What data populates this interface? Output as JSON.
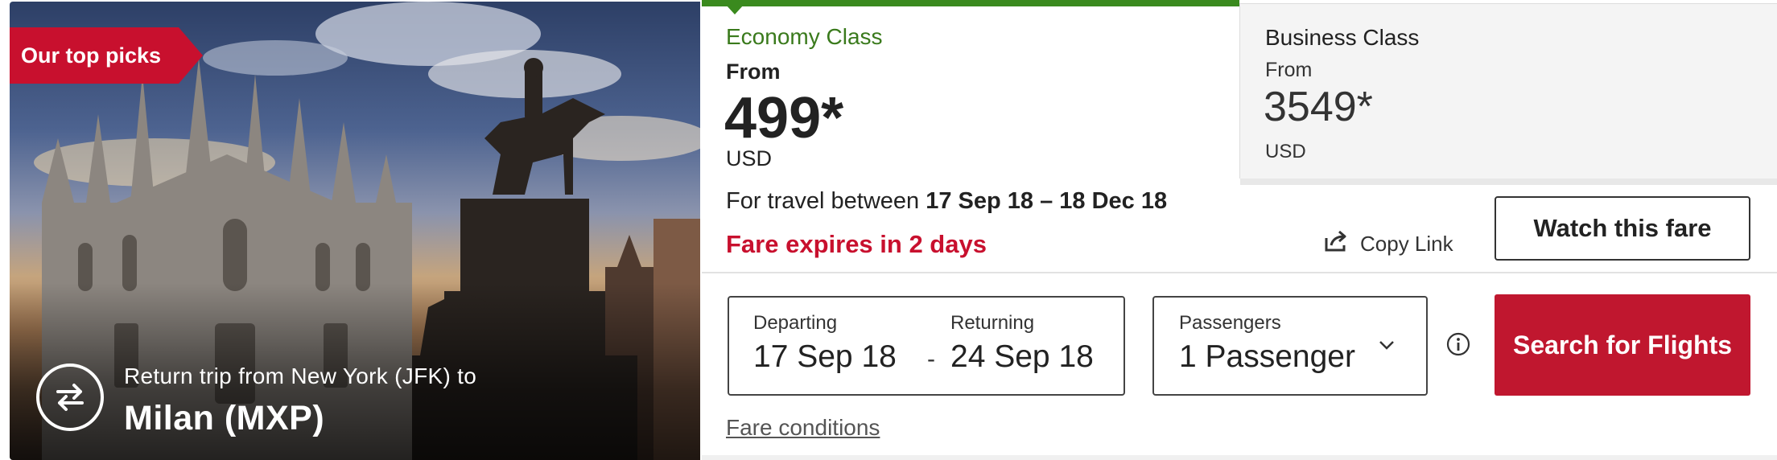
{
  "hero": {
    "badge": "Our top picks",
    "route_subtitle": "Return trip from New York (JFK) to",
    "destination": "Milan (MXP)",
    "route_icon": "round-trip-arrows-icon"
  },
  "fares": {
    "economy": {
      "label": "Economy Class",
      "from": "From",
      "price": "499*",
      "currency": "USD",
      "selected": true
    },
    "business": {
      "label": "Business Class",
      "from": "From",
      "price": "3549*",
      "currency": "USD",
      "selected": false
    }
  },
  "travel": {
    "prefix": "For travel between",
    "dates": "17 Sep 18 – 18 Dec 18",
    "expires": "Fare expires in 2 days"
  },
  "actions": {
    "copy_link": "Copy Link",
    "copy_link_icon": "share-icon",
    "watch": "Watch this fare",
    "search": "Search for Flights",
    "fare_conditions": "Fare conditions"
  },
  "form": {
    "departing_label": "Departing",
    "departing_value": "17 Sep 18",
    "date_separator": "-",
    "returning_label": "Returning",
    "returning_value": "24 Sep 18",
    "passengers_label": "Passengers",
    "passengers_value": "1 Passenger",
    "info_icon": "info-icon"
  },
  "colors": {
    "brand_red": "#c8102e",
    "economy_green": "#3a8a1e",
    "expire_red": "#c8102e"
  }
}
